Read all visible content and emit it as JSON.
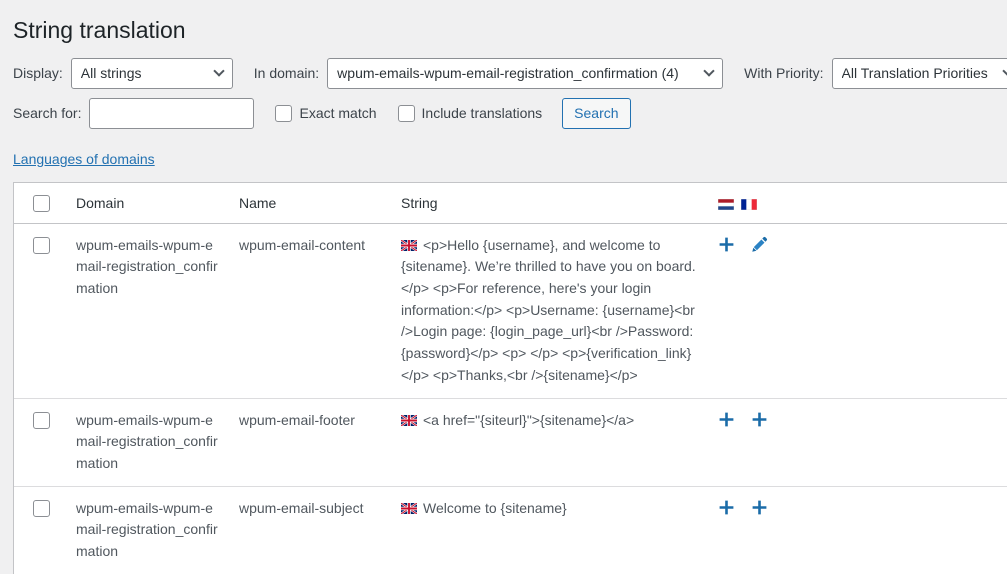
{
  "page_title": "String translation",
  "filters": {
    "display_label": "Display:",
    "display_value": "All strings",
    "domain_label": "In domain:",
    "domain_value": "wpum-emails-wpum-email-registration_confirmation (4)",
    "priority_label": "With Priority:",
    "priority_value": "All Translation Priorities",
    "search_label": "Search for:",
    "search_value": "",
    "search_placeholder": "",
    "exact_match_label": "Exact match",
    "include_translations_label": "Include translations",
    "search_button_label": "Search"
  },
  "languages_link": "Languages of domains",
  "table": {
    "headers": {
      "domain": "Domain",
      "name": "Name",
      "string": "String"
    },
    "header_flags": [
      "nl-flag-icon",
      "fr-flag-icon"
    ],
    "rows": [
      {
        "domain": "wpum-emails-wpum-email-registration_confirmation",
        "name": "wpum-email-content",
        "flag": "gb-flag-icon",
        "string": "<p>Hello {username}, and welcome to {sitename}. We’re thrilled to have you on board. </p> <p>For reference, here's your login information:</p> <p>Username: {username}<br />Login page: {login_page_url}<br />Password: {password}</p> <p> </p> <p>{verification_link}</p> <p>Thanks,<br />{sitename}</p>",
        "actions": [
          "plus-icon",
          "pencil-icon"
        ]
      },
      {
        "domain": "wpum-emails-wpum-email-registration_confirmation",
        "name": "wpum-email-footer",
        "flag": "gb-flag-icon",
        "string": "<a href=\"{siteurl}\">{sitename}</a>",
        "actions": [
          "plus-icon",
          "plus-icon"
        ]
      },
      {
        "domain": "wpum-emails-wpum-email-registration_confirmation",
        "name": "wpum-email-subject",
        "flag": "gb-flag-icon",
        "string": "Welcome to {sitename}",
        "actions": [
          "plus-icon",
          "plus-icon"
        ]
      }
    ]
  },
  "colors": {
    "accent_link": "#2271b1",
    "page_bg": "#f0f0f1",
    "border": "#c3c4c7"
  }
}
